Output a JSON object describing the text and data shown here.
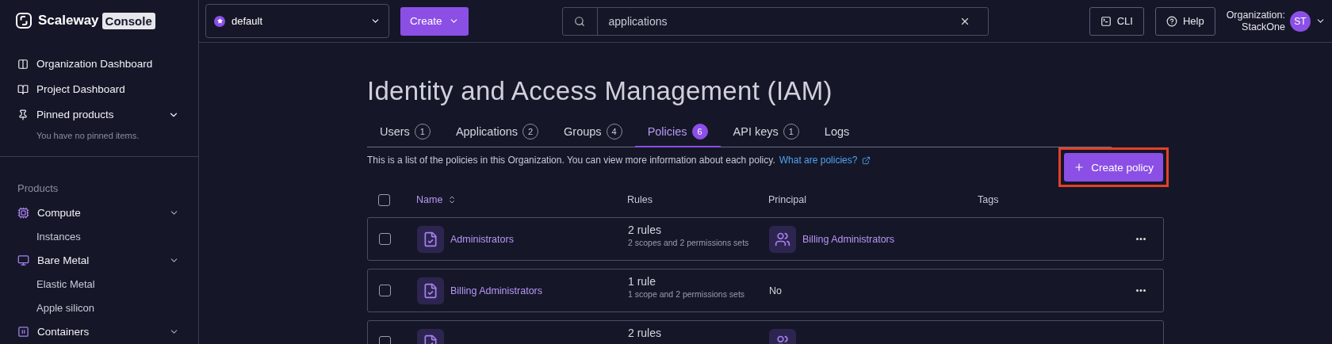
{
  "sidebar": {
    "logo": {
      "name": "Scaleway",
      "badge": "Console"
    },
    "nav": [
      {
        "label": "Organization Dashboard"
      },
      {
        "label": "Project Dashboard"
      },
      {
        "label": "Pinned products",
        "expanded": true,
        "note": "You have no pinned items."
      }
    ],
    "products_heading": "Products",
    "products": [
      {
        "label": "Compute",
        "expanded": true,
        "children": [
          {
            "label": "Instances"
          }
        ]
      },
      {
        "label": "Bare Metal",
        "expanded": true,
        "children": [
          {
            "label": "Elastic Metal"
          },
          {
            "label": "Apple silicon"
          }
        ]
      },
      {
        "label": "Containers",
        "expanded": true
      }
    ]
  },
  "topbar": {
    "project": "default",
    "create": "Create",
    "search": {
      "value": "applications"
    },
    "cli": "CLI",
    "help": "Help",
    "org_label": "Organization:",
    "org_name": "StackOne",
    "avatar": "ST"
  },
  "page": {
    "title": "Identity and Access Management (IAM)",
    "tabs": [
      {
        "label": "Users",
        "count": "1",
        "selected": false
      },
      {
        "label": "Applications",
        "count": "2",
        "selected": false
      },
      {
        "label": "Groups",
        "count": "4",
        "selected": false
      },
      {
        "label": "Policies",
        "count": "6",
        "selected": true
      },
      {
        "label": "API keys",
        "count": "1",
        "selected": false
      },
      {
        "label": "Logs",
        "selected": false
      }
    ],
    "description": "This is a list of the policies in this Organization. You can view more information about each policy.",
    "link": "What are policies?",
    "create_button": {
      "label": "Create policy",
      "highlighted": true
    },
    "table": {
      "select_all_checked": false,
      "columns": [
        "Name",
        "Rules",
        "Principal",
        "Tags"
      ],
      "rows": [
        {
          "name": "Administrators",
          "rules": "2 rules",
          "rules_detail": "2 scopes and 2 permissions sets",
          "principal": {
            "kind": "group",
            "label": "Billing Administrators"
          },
          "checked": false
        },
        {
          "name": "Billing Administrators",
          "rules": "1 rule",
          "rules_detail": "1 scope and 2 permissions sets",
          "principal": {
            "kind": "none",
            "label": "No"
          },
          "checked": false
        },
        {
          "rules": "2 rules",
          "principal": {
            "kind": "group"
          },
          "checked": false
        }
      ]
    }
  }
}
